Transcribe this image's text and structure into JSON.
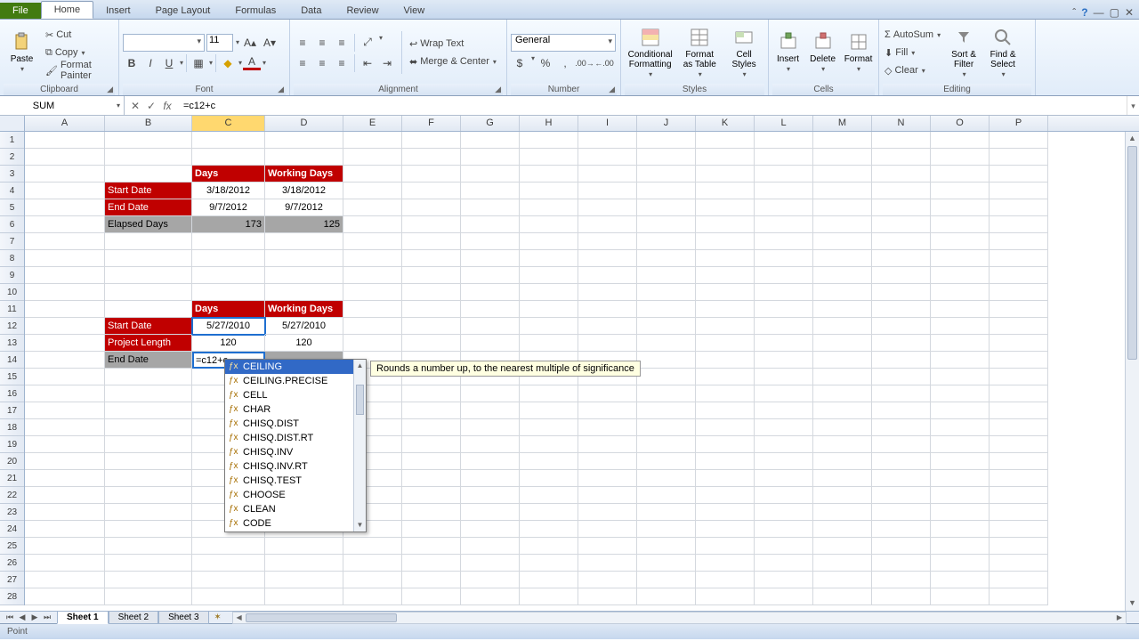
{
  "tabs": {
    "file": "File",
    "items": [
      "Home",
      "Insert",
      "Page Layout",
      "Formulas",
      "Data",
      "Review",
      "View"
    ],
    "active": "Home"
  },
  "ribbon": {
    "clipboard": {
      "paste": "Paste",
      "cut": "Cut",
      "copy": "Copy",
      "format_painter": "Format Painter",
      "label": "Clipboard"
    },
    "font": {
      "size": "11",
      "label": "Font"
    },
    "alignment": {
      "wrap": "Wrap Text",
      "merge": "Merge & Center",
      "label": "Alignment"
    },
    "number": {
      "format": "General",
      "label": "Number"
    },
    "styles": {
      "cf": "Conditional\nFormatting",
      "fat": "Format\nas Table",
      "cs": "Cell\nStyles",
      "label": "Styles"
    },
    "cells": {
      "insert": "Insert",
      "delete": "Delete",
      "format": "Format",
      "label": "Cells"
    },
    "editing": {
      "autosum": "AutoSum",
      "fill": "Fill",
      "clear": "Clear",
      "sort": "Sort &\nFilter",
      "find": "Find &\nSelect",
      "label": "Editing"
    }
  },
  "name_box": "SUM",
  "formula": "=c12+c",
  "columns": [
    "A",
    "B",
    "C",
    "D",
    "E",
    "F",
    "G",
    "H",
    "I",
    "J",
    "K",
    "L",
    "M",
    "N",
    "O",
    "P"
  ],
  "col_widths": {
    "A": 90,
    "B": 98,
    "C": 82,
    "D": 88,
    "default": 66
  },
  "selected_col": "C",
  "block1": {
    "h1": "Days",
    "h2": "Working Days",
    "r1": "Start Date",
    "r1c": "3/18/2012",
    "r1d": "3/18/2012",
    "r2": "End Date",
    "r2c": "9/7/2012",
    "r2d": "9/7/2012",
    "r3": "Elapsed Days",
    "r3c": "173",
    "r3d": "125"
  },
  "block2": {
    "h1": "Days",
    "h2": "Working Days",
    "r1": "Start Date",
    "r1c": "5/27/2010",
    "r1d": "5/27/2010",
    "r2": "Project Length",
    "r2c": "120",
    "r2d": "120",
    "r3": "End Date",
    "r3c": "=c12+c"
  },
  "autocomplete": {
    "items": [
      "CEILING",
      "CEILING.PRECISE",
      "CELL",
      "CHAR",
      "CHISQ.DIST",
      "CHISQ.DIST.RT",
      "CHISQ.INV",
      "CHISQ.INV.RT",
      "CHISQ.TEST",
      "CHOOSE",
      "CLEAN",
      "CODE"
    ],
    "selected": "CEILING",
    "tip": "Rounds a number up, to the nearest multiple of significance"
  },
  "sheets": {
    "items": [
      "Sheet 1",
      "Sheet 2",
      "Sheet 3"
    ],
    "active": "Sheet 1"
  },
  "status": "Point"
}
